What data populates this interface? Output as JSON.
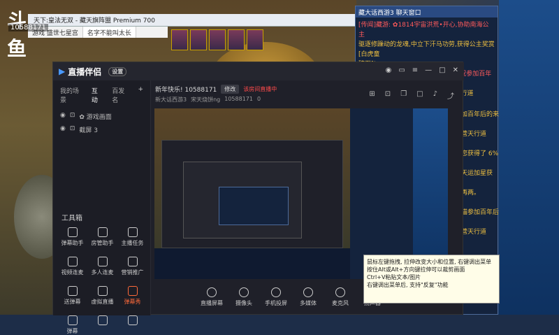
{
  "overlay": {
    "logo_text": "斗鱼",
    "room_id": "10588171"
  },
  "game_window": {
    "title": "天下:皇法无双 - 藏天旗阵盟 Premium 700",
    "tabs": [
      "游戏 盛世七星宫",
      "名字不能叫太长"
    ]
  },
  "chat_panel": {
    "header": "藏大话西游3 聊天窗口",
    "lines": [
      {
        "text": "[传闻]藏游: ✿1814宇宙洪荒•开心,协助南海公主",
        "red": true
      },
      {
        "text": "驱逐修躁动的龙魂,中立下汗马功劳,获得公主奖赏[白虎童"
      },
      {
        "text": "碎石]!"
      },
      {
        "text": "[传闻] [百年后的奇遇] (碎片) ✿中状况参加百年后的",
        "red": true
      },
      {
        "text": "奇遇, 在本关中获得了额外奖励, 营天行道"
      }
    ],
    "side_fragments": [
      "加百年后的来",
      "营天行道",
      "您获得了 6%",
      "天运加星获",
      "再两。",
      "猫参加百年后",
      "营天行道"
    ]
  },
  "app": {
    "brand": "直播伴侣",
    "badge": "设置",
    "header_icons": [
      "skin-icon",
      "message-icon",
      "menu-icon",
      "minimize-icon",
      "maximize-icon",
      "close-icon"
    ],
    "sidebar": {
      "tabs": [
        "我的场景",
        "互动",
        "百发名"
      ],
      "active_tab": 1,
      "sources": [
        "✿ 游戏画面",
        "截屏 3"
      ],
      "tools_title": "工具箱",
      "tools": [
        {
          "label": "弹幕助手",
          "icon": "danmaku-icon",
          "hot": false
        },
        {
          "label": "房管助手",
          "icon": "moderator-icon",
          "hot": false
        },
        {
          "label": "主播任务",
          "icon": "task-icon",
          "hot": false
        },
        {
          "label": "视频连麦",
          "icon": "video-link-icon",
          "hot": false
        },
        {
          "label": "多人连麦",
          "icon": "multi-link-icon",
          "hot": false
        },
        {
          "label": "营销推广",
          "icon": "promotion-icon",
          "hot": false
        },
        {
          "label": "送弹幕",
          "icon": "send-danmaku-icon",
          "hot": false
        },
        {
          "label": "虚拟直播",
          "icon": "virtual-live-icon",
          "hot": false
        },
        {
          "label": "弹幕秀",
          "icon": "danmaku-show-icon",
          "hot": true
        },
        {
          "label": "弹幕",
          "icon": "danmaku-small-icon",
          "hot": false
        },
        {
          "label": "",
          "icon": "gift-icon",
          "hot": false
        },
        {
          "label": "",
          "icon": "download-icon",
          "hot": false
        }
      ]
    },
    "stream": {
      "title": "新年快乐! 10588171",
      "edit_label": "修改",
      "status": "该房间直播中",
      "category": "新大话西游3",
      "streamer": "宋天烧饼ng",
      "room": "10588171",
      "viewers": "0"
    },
    "right_icons": [
      "grid-icon",
      "lock-icon",
      "copy-icon",
      "square-icon",
      "bell-icon",
      "share-icon"
    ],
    "bottom_buttons": [
      {
        "label": "直播屏幕",
        "icon": "screen-icon"
      },
      {
        "label": "摄像头",
        "icon": "camera-icon"
      },
      {
        "label": "手机投屏",
        "icon": "phone-cast-icon"
      },
      {
        "label": "多媒体",
        "icon": "media-icon"
      },
      {
        "label": "麦克风",
        "icon": "mic-icon"
      },
      {
        "label": "扬声器",
        "icon": "speaker-icon"
      }
    ]
  },
  "tooltip": {
    "lines": [
      "鼠标左键拖拽, 拉伸改变大小和位置, 右键调出菜单",
      "按住Alt或Alt+方向键拉伸可以裁剪画面",
      "Ctrl+V粘贴文本/图片",
      "右键调出菜单后, 支持\"反复\"功能"
    ]
  }
}
